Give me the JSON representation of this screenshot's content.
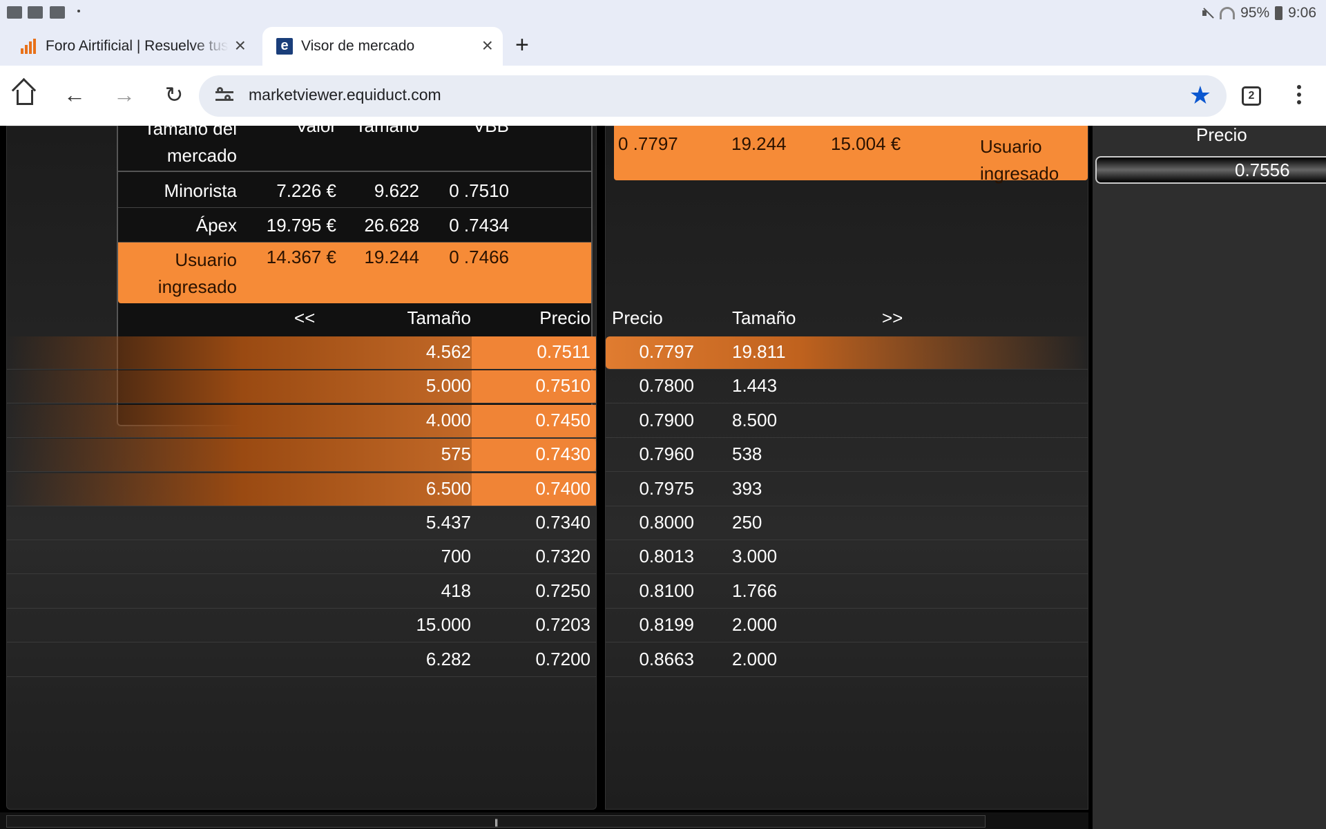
{
  "statusbar": {
    "battery": "95%",
    "time": "9:06"
  },
  "tabs": [
    {
      "label": "Foro Airtificial | Resuelve tus",
      "active": false,
      "icon": "chart-icon"
    },
    {
      "label": "Visor de mercado",
      "active": true,
      "icon": "equiduct-e-icon"
    }
  ],
  "toolbar": {
    "url": "marketviewer.equiduct.com",
    "tab_count": "2"
  },
  "summary": {
    "headers": [
      "Tamaño del mercado",
      "Valor",
      "Tamaño",
      "VBB"
    ],
    "rows": [
      {
        "label": "Minorista",
        "valor": "7.226 €",
        "tamano": "9.622",
        "vbb": "0 .7510"
      },
      {
        "label": "Ápex",
        "valor": "19.795 €",
        "tamano": "26.628",
        "vbb": "0 .7434"
      },
      {
        "label": "Usuario ingresado",
        "valor": "14.367 €",
        "tamano": "19.244",
        "vbb": "0 .7466"
      }
    ]
  },
  "ask_summary": {
    "vbb": "0 .7797",
    "tamano": "19.244",
    "valor": "15.004 €",
    "label": "Usuario ingresado"
  },
  "bids": {
    "nav": "<<",
    "headers": [
      "Tamaño",
      "Precio"
    ],
    "rows": [
      {
        "size": "4.562",
        "price": "0.7511",
        "highlight": true
      },
      {
        "size": "5.000",
        "price": "0.7510",
        "highlight": true
      },
      {
        "size": "4.000",
        "price": "0.7450",
        "highlight": true
      },
      {
        "size": "575",
        "price": "0.7430",
        "highlight": true
      },
      {
        "size": "6.500",
        "price": "0.7400",
        "highlight": true
      },
      {
        "size": "5.437",
        "price": "0.7340",
        "highlight": false
      },
      {
        "size": "700",
        "price": "0.7320",
        "highlight": false
      },
      {
        "size": "418",
        "price": "0.7250",
        "highlight": false
      },
      {
        "size": "15.000",
        "price": "0.7203",
        "highlight": false
      },
      {
        "size": "6.282",
        "price": "0.7200",
        "highlight": false
      }
    ]
  },
  "asks": {
    "nav": ">>",
    "headers": [
      "Precio",
      "Tamaño"
    ],
    "rows": [
      {
        "price": "0.7797",
        "size": "19.811",
        "highlight": true
      },
      {
        "price": "0.7800",
        "size": "1.443",
        "highlight": false
      },
      {
        "price": "0.7900",
        "size": "8.500",
        "highlight": false
      },
      {
        "price": "0.7960",
        "size": "538",
        "highlight": false
      },
      {
        "price": "0.7975",
        "size": "393",
        "highlight": false
      },
      {
        "price": "0.8000",
        "size": "250",
        "highlight": false
      },
      {
        "price": "0.8013",
        "size": "3.000",
        "highlight": false
      },
      {
        "price": "0.8100",
        "size": "1.766",
        "highlight": false
      },
      {
        "price": "0.8199",
        "size": "2.000",
        "highlight": false
      },
      {
        "price": "0.8663",
        "size": "2.000",
        "highlight": false
      }
    ]
  },
  "side": {
    "header": "Precio",
    "value": "0.7556"
  },
  "colors": {
    "accent": "#f68b37",
    "star": "#0b57d0"
  }
}
